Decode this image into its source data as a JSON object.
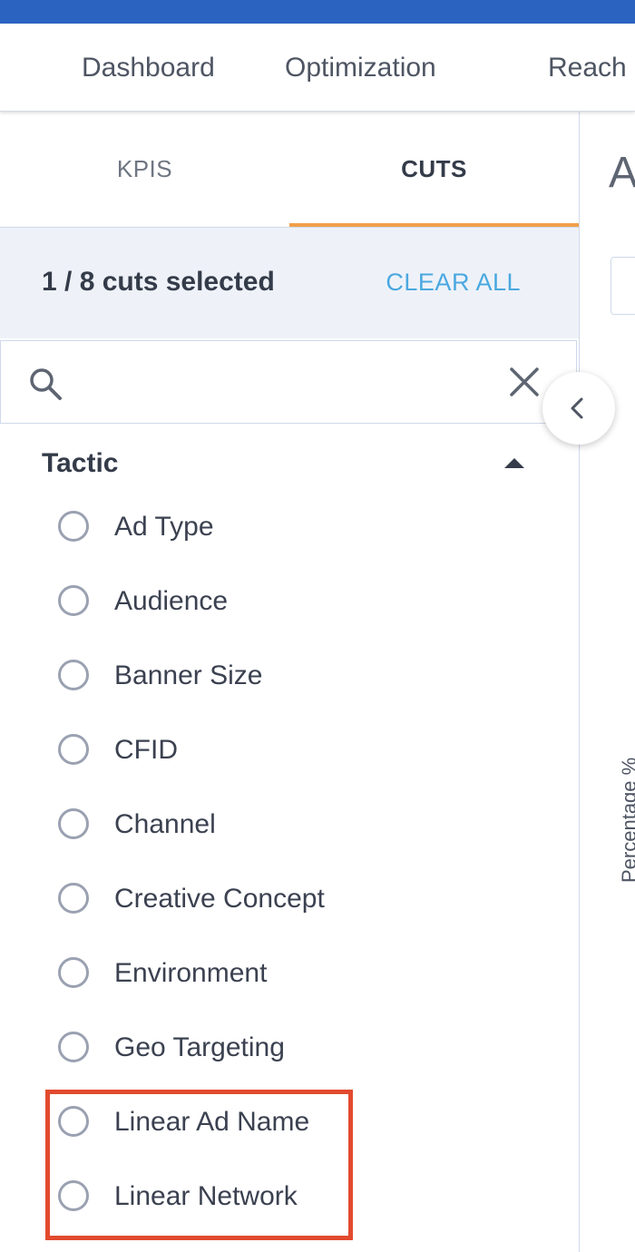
{
  "nav": {
    "tabs": [
      {
        "label": "Dashboard"
      },
      {
        "label": "Optimization"
      },
      {
        "label": "Reach"
      }
    ]
  },
  "panel": {
    "subtabs": [
      {
        "label": "KPIS",
        "active": false
      },
      {
        "label": "CUTS",
        "active": true
      }
    ],
    "selection": {
      "count_text": "1 / 8 cuts selected",
      "clear_label": "CLEAR ALL"
    },
    "search": {
      "value": "",
      "placeholder": ""
    },
    "group": {
      "title": "Tactic",
      "expanded": true,
      "items": [
        {
          "label": "Ad Type",
          "selected": false
        },
        {
          "label": "Audience",
          "selected": false
        },
        {
          "label": "Banner Size",
          "selected": false
        },
        {
          "label": "CFID",
          "selected": false
        },
        {
          "label": "Channel",
          "selected": false
        },
        {
          "label": "Creative Concept",
          "selected": false
        },
        {
          "label": "Environment",
          "selected": false
        },
        {
          "label": "Geo Targeting",
          "selected": false
        },
        {
          "label": "Linear Ad Name",
          "selected": false
        },
        {
          "label": "Linear Network",
          "selected": false
        }
      ]
    }
  },
  "main": {
    "heading_partial": "A",
    "y_axis_label_partial": "Percentage %"
  },
  "colors": {
    "top_bar": "#2a63c0",
    "active_tab_underline": "#f0a04b",
    "clear_all": "#4aa8e0",
    "highlight": "#e24a2e",
    "selection_bar_bg": "#eef2f8"
  }
}
